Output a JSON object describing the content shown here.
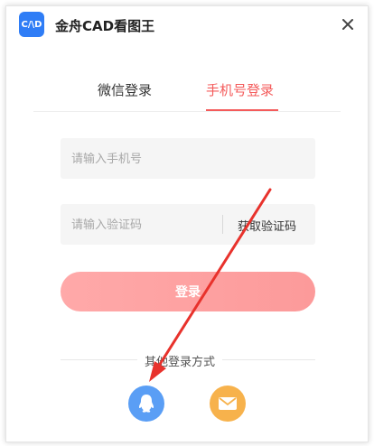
{
  "app": {
    "logo_text": "C/\\D",
    "title": "金舟CAD看图王"
  },
  "tabs": [
    {
      "label": "微信登录",
      "active": false
    },
    {
      "label": "手机号登录",
      "active": true
    }
  ],
  "form": {
    "phone_placeholder": "请输入手机号",
    "code_placeholder": "请输入验证码",
    "get_code_label": "获取验证码",
    "login_label": "登录"
  },
  "other": {
    "label": "其他登录方式",
    "methods": [
      {
        "icon": "qq-icon",
        "color": "#5a9ef5"
      },
      {
        "icon": "mail-icon",
        "color": "#f7b24c"
      }
    ]
  },
  "colors": {
    "accent": "#f45b5b",
    "brand": "#2f7df6",
    "annotation_arrow": "#e8322c"
  }
}
